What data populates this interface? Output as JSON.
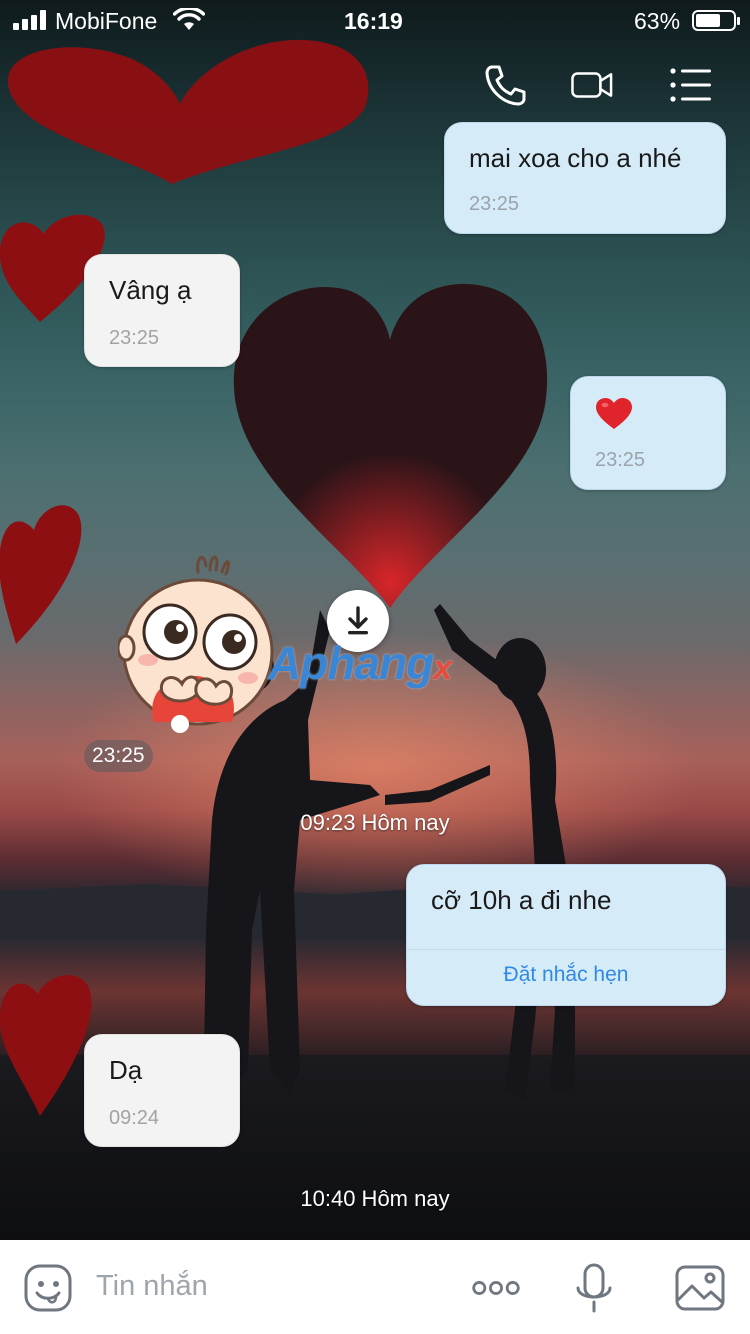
{
  "status_bar": {
    "carrier": "MobiFone",
    "time": "16:19",
    "battery_percent": "63%",
    "battery_level": 0.63,
    "signal_bars": 4
  },
  "header": {
    "icons": [
      "phone-call-icon",
      "video-call-icon",
      "menu-list-icon"
    ]
  },
  "messages": [
    {
      "direction": "outgoing",
      "text": "mai xoa cho a nhé",
      "time": "23:25"
    },
    {
      "direction": "incoming",
      "text": "Vâng ạ",
      "time": "23:25"
    },
    {
      "direction": "outgoing",
      "emoji": "red-heart",
      "time": "23:25"
    },
    {
      "direction": "incoming",
      "sticker": "baby-sticker",
      "time": "23:25"
    },
    {
      "direction": "outgoing",
      "text": "cỡ 10h a đi nhe",
      "action": "Đặt nhắc hẹn"
    },
    {
      "direction": "incoming",
      "text": "Dạ",
      "time": "09:24"
    }
  ],
  "separators": [
    "09:23 Hôm nay",
    "10:40 Hôm nay"
  ],
  "watermark": {
    "main": "Aphang",
    "suffix": "x"
  },
  "composer": {
    "placeholder": "Tin nhắn",
    "icons": [
      "emoji-sticker-icon",
      "more-options-icon",
      "microphone-icon",
      "image-gallery-icon"
    ]
  },
  "colors": {
    "outgoing_bubble": "#d6ebf8",
    "incoming_bubble": "#f3f3f3",
    "link": "#2e8ae6",
    "heart": "#8e0f12"
  }
}
